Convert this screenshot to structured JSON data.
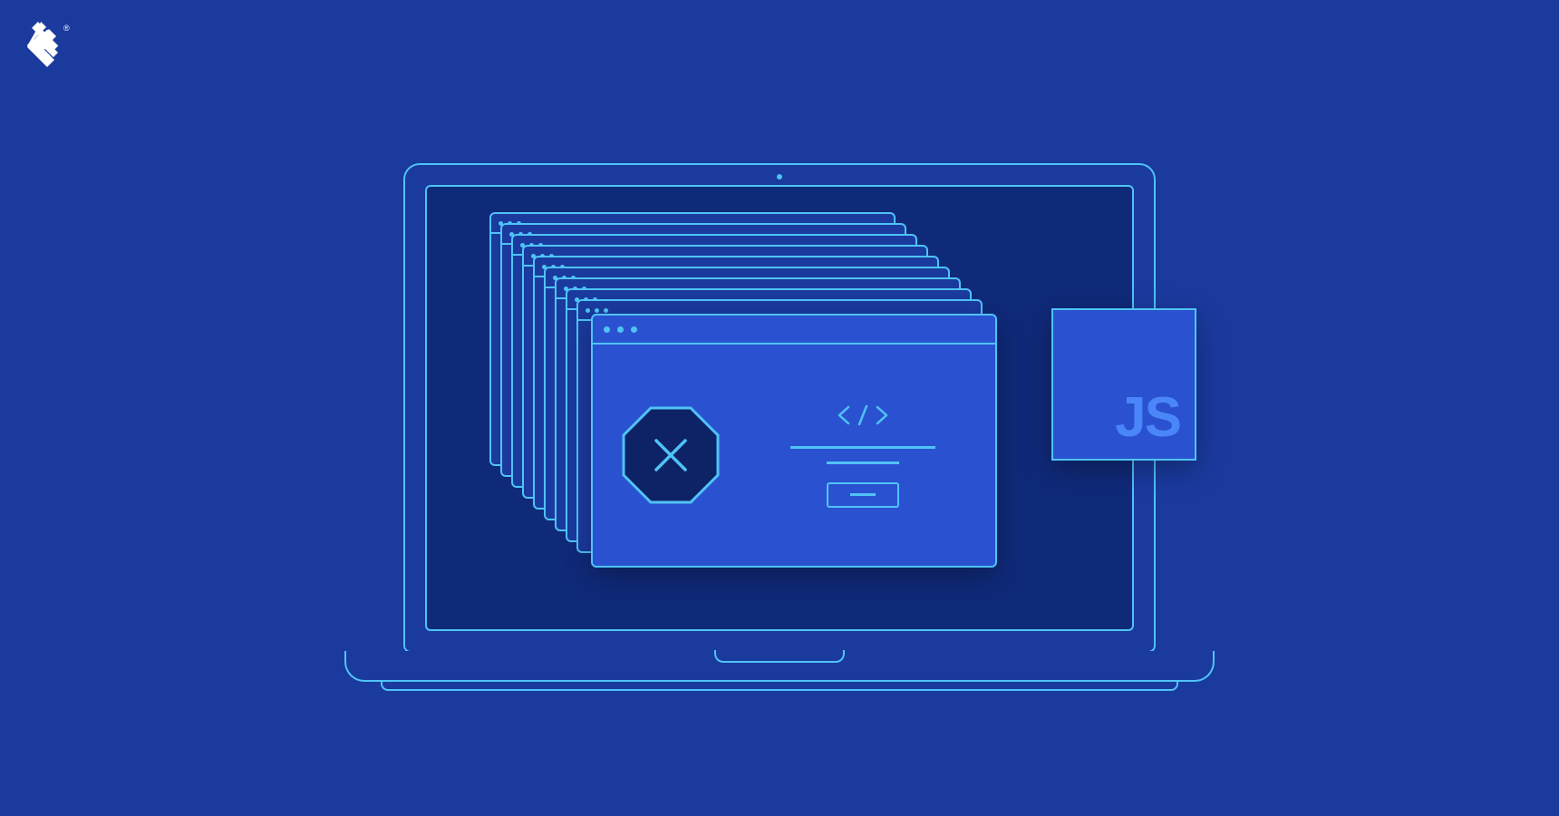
{
  "brand": {
    "name": "Toptal",
    "logo_color": "#ffffff"
  },
  "colors": {
    "background": "#1a3a9e",
    "screen": "#102a7a",
    "stroke": "#4fc3f7",
    "window_fill": "#2a52d0",
    "octagon_fill": "#0d2366",
    "js_text": "#4a86f7"
  },
  "badge": {
    "label": "JS"
  },
  "error_window": {
    "code_symbol": "</>",
    "error_icon": "x-octagon"
  },
  "window_stack": {
    "count": 10
  }
}
